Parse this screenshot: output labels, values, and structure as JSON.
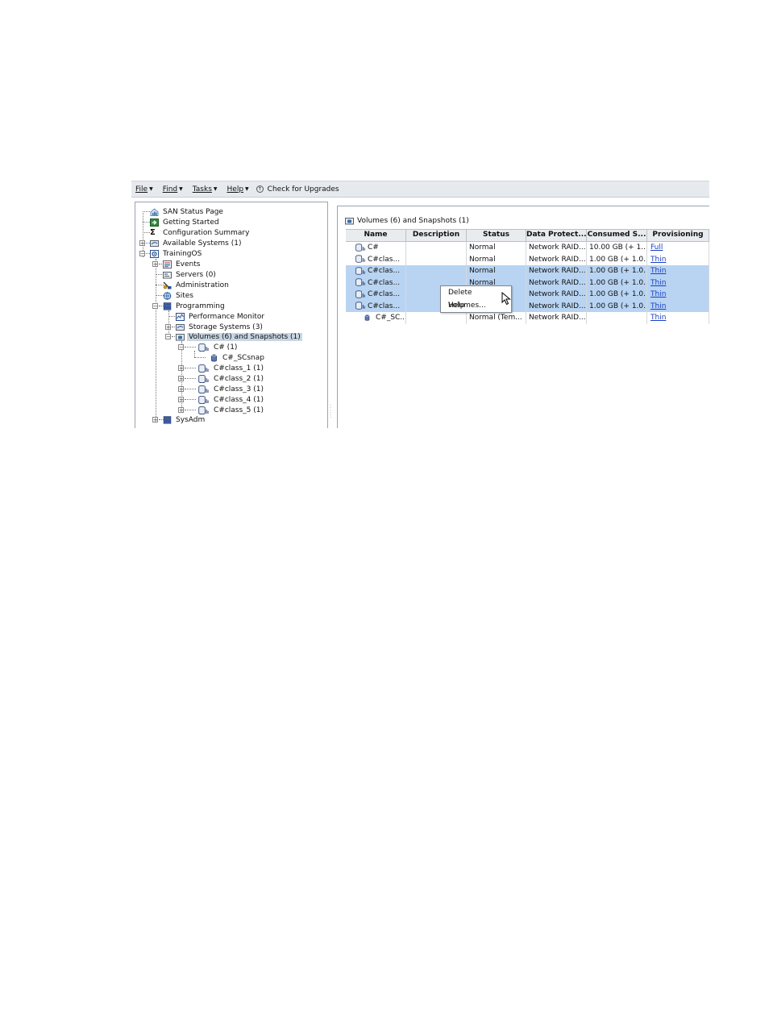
{
  "menubar": {
    "items": [
      {
        "label": "File",
        "icon": "caret-down-icon"
      },
      {
        "label": "Find",
        "icon": "caret-down-icon"
      },
      {
        "label": "Tasks",
        "icon": "caret-down-icon"
      },
      {
        "label": "Help",
        "icon": "caret-down-icon"
      }
    ],
    "upgrades_label": "Check for Upgrades"
  },
  "tree": {
    "items": [
      {
        "label": "SAN Status Page",
        "icon": "home-chart-icon"
      },
      {
        "label": "Getting Started",
        "icon": "green-arrow-icon"
      },
      {
        "label": "Configuration Summary",
        "icon": "sigma-icon"
      },
      {
        "label": "Available Systems (1)",
        "icon": "storage-system-icon"
      },
      {
        "label": "TrainingOS",
        "icon": "management-group-icon"
      },
      {
        "label": "Events",
        "icon": "events-icon"
      },
      {
        "label": "Servers (0)",
        "icon": "servers-icon"
      },
      {
        "label": "Administration",
        "icon": "administration-icon"
      },
      {
        "label": "Sites",
        "icon": "globe-icon"
      },
      {
        "label": "Programming",
        "icon": "cluster-icon"
      },
      {
        "label": "Performance Monitor",
        "icon": "performance-monitor-icon"
      },
      {
        "label": "Storage Systems (3)",
        "icon": "storage-system-icon"
      },
      {
        "label": "Volumes (6) and Snapshots (1)",
        "icon": "volumes-folder-icon"
      },
      {
        "label": "C# (1)",
        "icon": "volume-icon"
      },
      {
        "label": "C#_SCsnap",
        "icon": "snapshot-icon"
      },
      {
        "label": "C#class_1 (1)",
        "icon": "volume-icon"
      },
      {
        "label": "C#class_2 (1)",
        "icon": "volume-icon"
      },
      {
        "label": "C#class_3 (1)",
        "icon": "volume-icon"
      },
      {
        "label": "C#class_4 (1)",
        "icon": "volume-icon"
      },
      {
        "label": "C#class_5 (1)",
        "icon": "volume-icon"
      },
      {
        "label": "SysAdm",
        "icon": "cluster-icon"
      }
    ]
  },
  "panel": {
    "title": "Volumes (6) and Snapshots (1)",
    "columns": [
      "Name",
      "Description",
      "Status",
      "Data Protect...",
      "Consumed S...",
      "Provisioning"
    ],
    "rows": [
      {
        "name": "C#",
        "description": "",
        "status": "Normal",
        "protection": "Network RAID...",
        "consumed": "10.00 GB (+ 1....",
        "provisioning": "Full",
        "selected": false,
        "icon": "volume-icon"
      },
      {
        "name": "C#clas...",
        "description": "",
        "status": "Normal",
        "protection": "Network RAID...",
        "consumed": "1.00 GB (+ 1.0...",
        "provisioning": "Thin",
        "selected": false,
        "icon": "volume-icon"
      },
      {
        "name": "C#clas...",
        "description": "",
        "status": "Normal",
        "protection": "Network RAID...",
        "consumed": "1.00 GB (+ 1.0...",
        "provisioning": "Thin",
        "selected": true,
        "icon": "volume-icon"
      },
      {
        "name": "C#clas...",
        "description": "",
        "status": "Normal",
        "protection": "Network RAID...",
        "consumed": "1.00 GB (+ 1.0...",
        "provisioning": "Thin",
        "selected": true,
        "icon": "volume-icon"
      },
      {
        "name": "C#clas...",
        "description": "",
        "status": "",
        "protection": "Network RAID...",
        "consumed": "1.00 GB (+ 1.0...",
        "provisioning": "Thin",
        "selected": true,
        "icon": "volume-icon"
      },
      {
        "name": "C#clas...",
        "description": "",
        "status": "",
        "protection": "Network RAID...",
        "consumed": "1.00 GB (+ 1.0...",
        "provisioning": "Thin",
        "selected": true,
        "icon": "volume-icon"
      },
      {
        "name": "C#_SC...",
        "description": "",
        "status": "Normal (Tem...",
        "protection": "Network RAID...",
        "consumed": "",
        "provisioning": "Thin",
        "selected": false,
        "icon": "snapshot-icon"
      }
    ]
  },
  "context_menu": {
    "items": [
      "Delete Volumes...",
      "Help"
    ]
  },
  "colors": {
    "selection": "#b8d4f2",
    "tree_selection": "#c8d5e3",
    "link": "#1a3fc4",
    "menubar": "#e6eaef"
  }
}
